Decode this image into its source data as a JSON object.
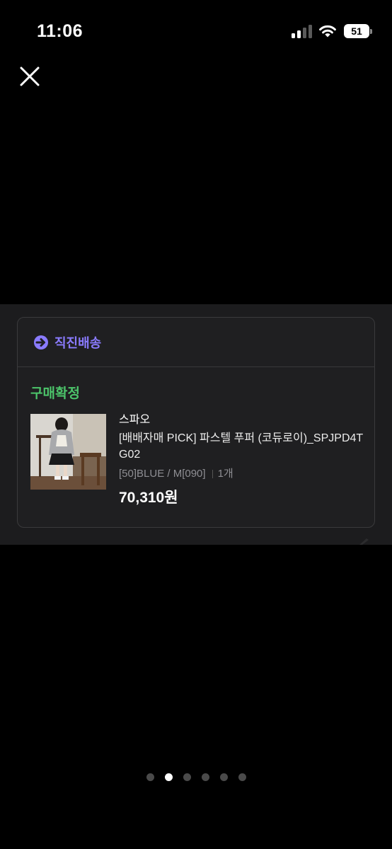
{
  "status_bar": {
    "time": "11:06",
    "battery": "51",
    "icons": [
      "signal-icon",
      "wifi-icon",
      "battery-icon"
    ]
  },
  "viewer": {
    "close_icon": "close-icon",
    "page_count": 6,
    "active_page": 2
  },
  "order_card": {
    "delivery_label": "직진배송",
    "delivery_icon": "arrow-circle-icon",
    "status": "구매확정",
    "brand": "스파오",
    "product_name": "[배배자매 PICK] 파스텔 푸퍼 (코듀로이)_SPJPD4TG02",
    "option": "[50]BLUE / M[090]",
    "quantity": "1개",
    "price": "70,310원"
  },
  "colors": {
    "background": "#000000",
    "panel": "#1c1c1e",
    "accent_purple": "#8a7bff",
    "status_green": "#4cc46a",
    "muted_text": "#8e8e93"
  }
}
